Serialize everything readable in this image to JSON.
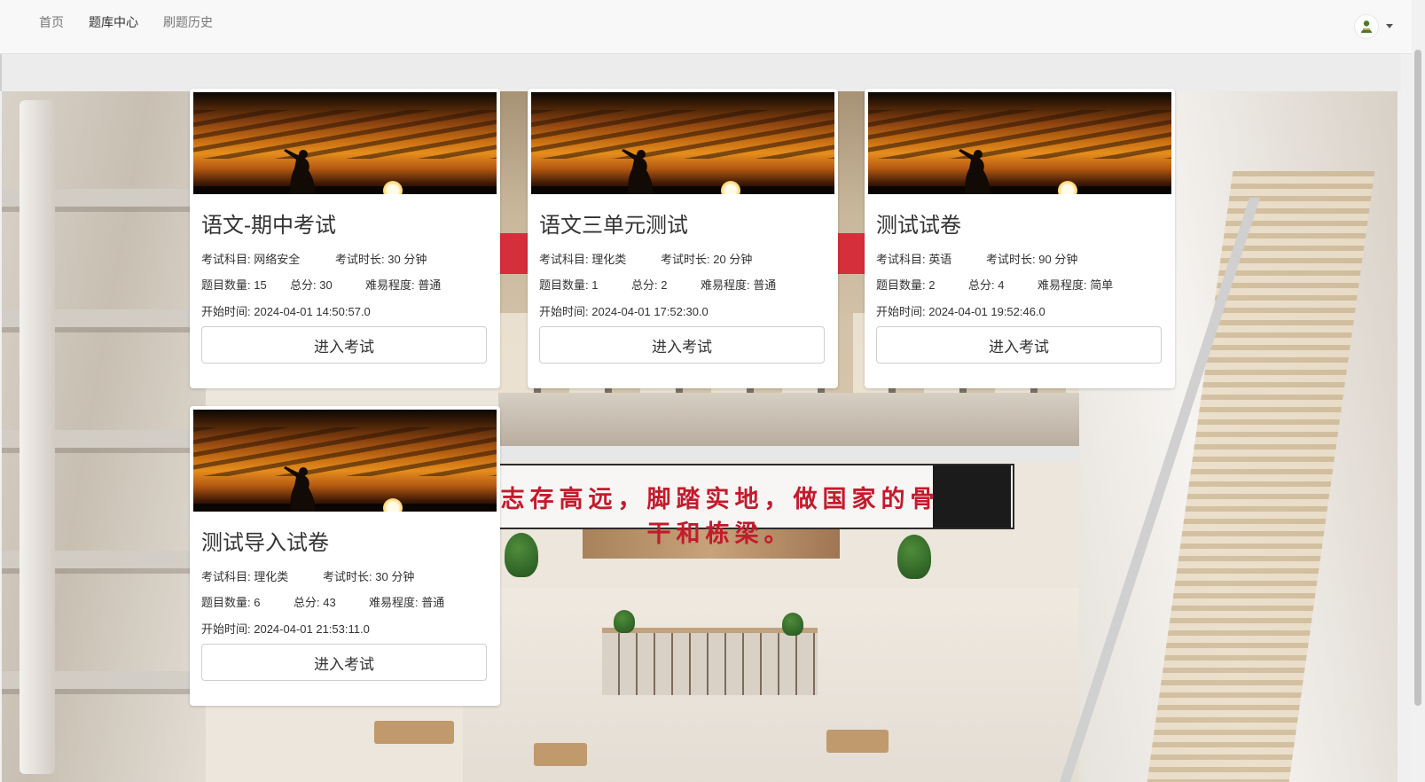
{
  "nav": {
    "items": [
      {
        "label": "首页",
        "active": false
      },
      {
        "label": "题库中心",
        "active": true
      },
      {
        "label": "刷题历史",
        "active": false
      }
    ],
    "user_avatar_icon": "user-avatar-icon"
  },
  "background": {
    "banner_text": "志存高远，脚踏实地，做国家的骨干和栋梁。"
  },
  "labels": {
    "subject": "考试科目: ",
    "duration": "考试时长: ",
    "duration_unit": " 分钟",
    "question_count": "题目数量: ",
    "total_score": "总分: ",
    "difficulty": "难易程度: ",
    "start_time": "开始时间: ",
    "enter_button": "进入考试"
  },
  "exams": [
    {
      "title": "语文-期中考试",
      "subject": "网络安全",
      "duration": "30",
      "question_count": "15",
      "total_score": "30",
      "difficulty": "普通",
      "start_time": "2024-04-01 14:50:57.0"
    },
    {
      "title": "语文三单元测试",
      "subject": "理化类",
      "duration": "20",
      "question_count": "1",
      "total_score": "2",
      "difficulty": "普通",
      "start_time": "2024-04-01 17:52:30.0"
    },
    {
      "title": "测试试卷",
      "subject": "英语",
      "duration": "90",
      "question_count": "2",
      "total_score": "4",
      "difficulty": "简单",
      "start_time": "2024-04-01 19:52:46.0"
    },
    {
      "title": "测试导入试卷",
      "subject": "理化类",
      "duration": "30",
      "question_count": "6",
      "total_score": "43",
      "difficulty": "普通",
      "start_time": "2024-04-01 21:53:11.0"
    }
  ],
  "colors": {
    "navbar_bg": "#f8f8f8",
    "nav_active": "#333333",
    "nav_inactive": "#777777",
    "card_bg": "#ffffff",
    "banner_text": "#c31b2c"
  }
}
